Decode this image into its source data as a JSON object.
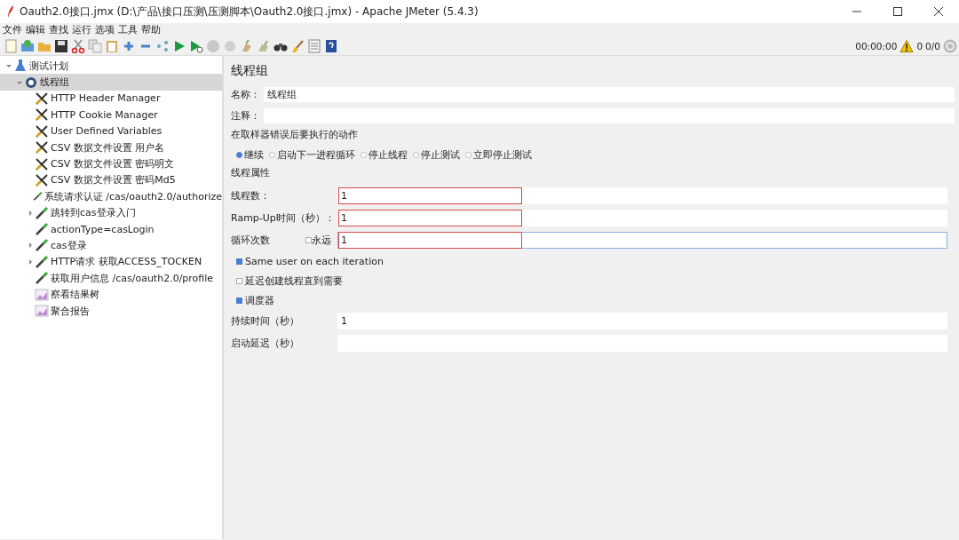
{
  "window": {
    "title": "Oauth2.0接口.jmx (D:\\产品\\接口压测\\压测脚本\\Oauth2.0接口.jmx) - Apache JMeter (5.4.3)"
  },
  "menu": [
    "文件",
    "编辑",
    "查找",
    "运行",
    "选项",
    "工具",
    "帮助"
  ],
  "status": {
    "timer": "00:00:00",
    "errors": "0",
    "threads": "0/0"
  },
  "tree": [
    {
      "label": "测试计划",
      "kind": "plan",
      "expandable": true,
      "expanded": true,
      "selected": false,
      "children": [
        {
          "label": "线程组",
          "kind": "threadgroup",
          "expandable": true,
          "expanded": true,
          "selected": true,
          "children": [
            {
              "label": "HTTP Header Manager",
              "kind": "config",
              "expandable": false,
              "selected": false
            },
            {
              "label": "HTTP Cookie Manager",
              "kind": "config",
              "expandable": false,
              "selected": false
            },
            {
              "label": "User Defined Variables",
              "kind": "config",
              "expandable": false,
              "selected": false
            },
            {
              "label": "CSV 数据文件设置 用户名",
              "kind": "config",
              "expandable": false,
              "selected": false
            },
            {
              "label": "CSV 数据文件设置 密码明文",
              "kind": "config",
              "expandable": false,
              "selected": false
            },
            {
              "label": "CSV 数据文件设置 密码Md5",
              "kind": "config",
              "expandable": false,
              "selected": false
            },
            {
              "label": "系统请求认证 /cas/oauth2.0/authorize",
              "kind": "sampler",
              "expandable": false,
              "selected": false
            },
            {
              "label": "跳转到cas登录入门",
              "kind": "sampler",
              "expandable": true,
              "expanded": false,
              "selected": false
            },
            {
              "label": "actionType=casLogin",
              "kind": "sampler",
              "expandable": false,
              "selected": false
            },
            {
              "label": "cas登录",
              "kind": "sampler",
              "expandable": true,
              "expanded": false,
              "selected": false
            },
            {
              "label": "HTTP请求 获取ACCESS_TOCKEN",
              "kind": "sampler",
              "expandable": true,
              "expanded": false,
              "selected": false
            },
            {
              "label": "获取用户信息 /cas/oauth2.0/profile",
              "kind": "sampler",
              "expandable": false,
              "selected": false
            },
            {
              "label": "察看结果树",
              "kind": "listener",
              "expandable": false,
              "selected": false
            },
            {
              "label": "聚合报告",
              "kind": "listener",
              "expandable": false,
              "selected": false
            }
          ]
        }
      ]
    }
  ],
  "panel": {
    "title": "线程组",
    "name": {
      "label": "名称：",
      "value": "线程组"
    },
    "comment": {
      "label": "注释："
    },
    "error_action": {
      "title": "在取样器错误后要执行的动作",
      "options": [
        {
          "label": "继续",
          "selected": true
        },
        {
          "label": "启动下一进程循环",
          "selected": false
        },
        {
          "label": "停止线程",
          "selected": false
        },
        {
          "label": "停止测试",
          "selected": false
        },
        {
          "label": "立即停止测试",
          "selected": false
        }
      ]
    },
    "properties_title": "线程属性",
    "rows": [
      {
        "kind": "field",
        "label": "线程数：",
        "value": "1",
        "highlighted": true,
        "focused": false
      },
      {
        "kind": "field",
        "label": "Ramp-Up时间（秒）：",
        "value": "1",
        "highlighted": true,
        "focused": false
      },
      {
        "kind": "loop",
        "label": "循环次数",
        "forever": {
          "label": "永远",
          "checked": false
        },
        "value": "1",
        "highlighted": true,
        "focused": true
      },
      {
        "kind": "check",
        "label": "Same user on each iteration",
        "checked": true
      },
      {
        "kind": "check",
        "label": "延迟创建线程直到需要",
        "checked": false
      },
      {
        "kind": "check",
        "label": "调度器",
        "checked": true
      },
      {
        "kind": "field",
        "label": "持续时间（秒）",
        "value": "1",
        "highlighted": false,
        "focused": false
      },
      {
        "kind": "field",
        "label": "启动延迟（秒）",
        "highlighted": false,
        "focused": false
      }
    ]
  }
}
